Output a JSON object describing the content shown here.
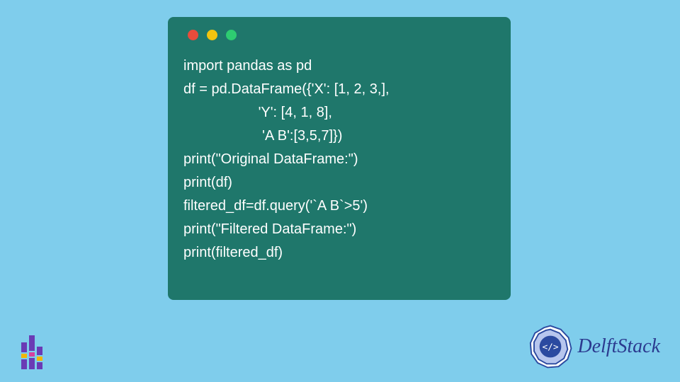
{
  "code": {
    "lines": [
      "import pandas as pd",
      "df = pd.DataFrame({'X': [1, 2, 3,],",
      "                   'Y': [4, 1, 8],",
      "                    'A B':[3,5,7]})",
      "print(\"Original DataFrame:\")",
      "print(df)",
      "filtered_df=df.query('`A B`>5')",
      "print(\"Filtered DataFrame:\")",
      "print(filtered_df)"
    ]
  },
  "window": {
    "dot_colors": {
      "red": "#e74c3c",
      "yellow": "#f1c40f",
      "green": "#2ecc71"
    }
  },
  "branding": {
    "delftstack": "DelftStack"
  }
}
